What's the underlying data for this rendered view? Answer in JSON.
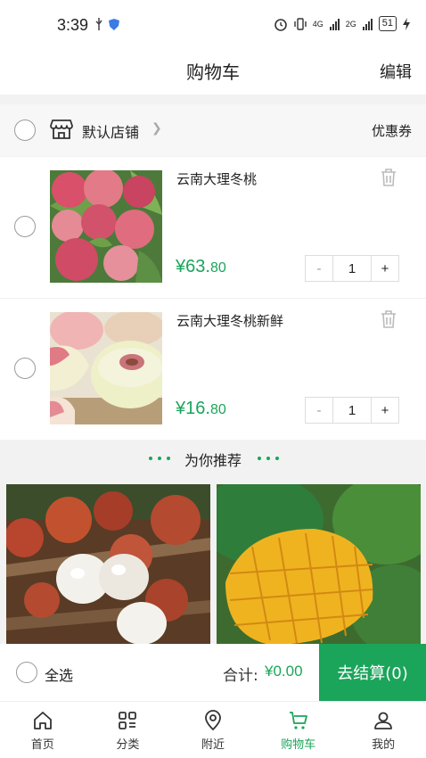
{
  "status_bar": {
    "time": "3:39",
    "battery": "51",
    "net1": "4G",
    "net2": "2G"
  },
  "header": {
    "title": "购物车",
    "edit": "编辑"
  },
  "shop": {
    "name": "默认店铺",
    "coupon": "优惠券"
  },
  "items": [
    {
      "name": "云南大理冬桃",
      "price_main": "¥63.",
      "price_cents": "80",
      "quantity": "1"
    },
    {
      "name": "云南大理冬桃新鲜",
      "price_main": "¥16.",
      "price_cents": "80",
      "quantity": "1"
    }
  ],
  "stepper": {
    "minus": "-",
    "plus": "+"
  },
  "recommend": {
    "title": "为你推荐"
  },
  "checkout": {
    "select_all": "全选",
    "total_label": "合计:",
    "total_value": "¥0.00",
    "button": "去结算(0)"
  },
  "tabs": [
    {
      "label": "首页",
      "icon": "home-icon"
    },
    {
      "label": "分类",
      "icon": "category-icon"
    },
    {
      "label": "附近",
      "icon": "location-icon"
    },
    {
      "label": "购物车",
      "icon": "cart-icon",
      "active": true
    },
    {
      "label": "我的",
      "icon": "user-icon"
    }
  ],
  "colors": {
    "accent": "#1aa55a"
  }
}
